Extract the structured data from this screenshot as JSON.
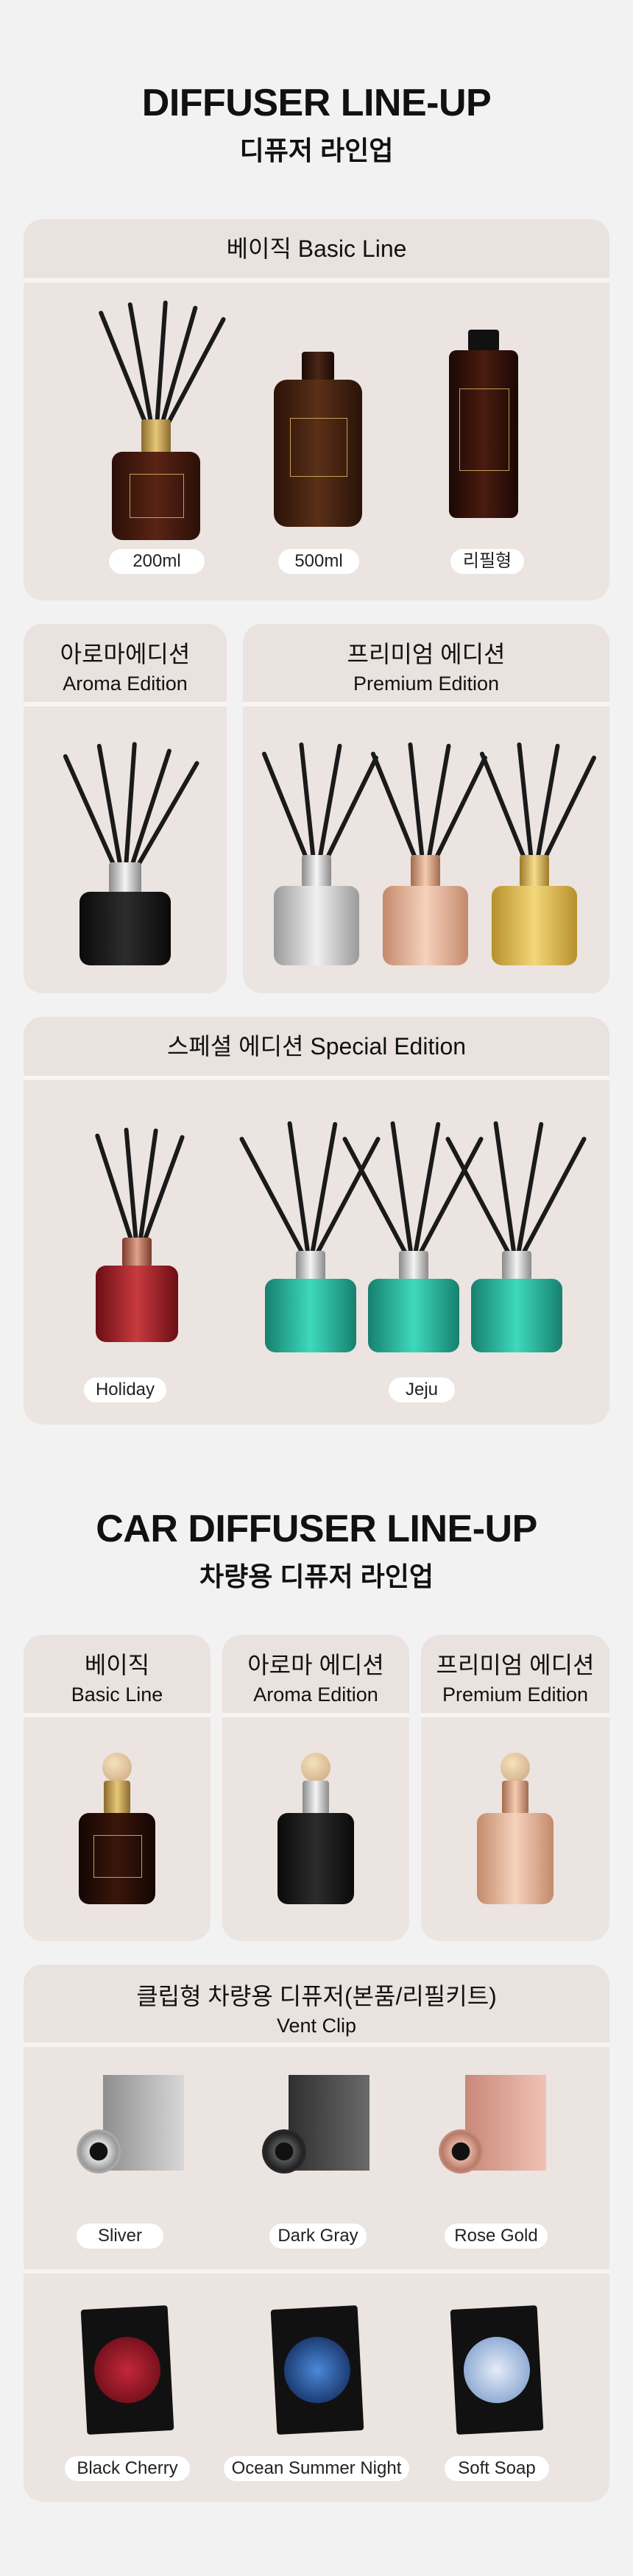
{
  "section1": {
    "title_en": "DIFFUSER LINE-UP",
    "title_ko": "디퓨저 라인업",
    "basic": {
      "header": "베이직 Basic Line",
      "labels": [
        "200ml",
        "500ml",
        "리필형"
      ]
    },
    "aroma": {
      "header_ko": "아로마에디션",
      "header_en": "Aroma Edition"
    },
    "premium": {
      "header_ko": "프리미엄 에디션",
      "header_en": "Premium Edition"
    },
    "special": {
      "header": "스페셜 에디션 Special Edition",
      "labels": [
        "Holiday",
        "Jeju"
      ]
    }
  },
  "section2": {
    "title_en": "CAR DIFFUSER LINE-UP",
    "title_ko": "차량용 디퓨저 라인업",
    "basic": {
      "header_ko": "베이직",
      "header_en": "Basic Line"
    },
    "aroma": {
      "header_ko": "아로마 에디션",
      "header_en": "Aroma Edition"
    },
    "premium": {
      "header_ko": "프리미엄 에디션",
      "header_en": "Premium Edition"
    },
    "vent": {
      "header_ko": "클립형 차량용 디퓨저(본품/리필키트)",
      "header_en": "Vent Clip",
      "colors": [
        "Sliver",
        "Dark Gray",
        "Rose Gold"
      ],
      "refills": [
        "Black Cherry",
        "Ocean Summer Night",
        "Soft Soap"
      ]
    }
  },
  "colors": {
    "page_bg": "#f2f2f2",
    "card_bg": "#ebe4e1",
    "amber": "#4a1e14",
    "black": "#1a1a1a",
    "silver": "#c9c9c9",
    "rose_gold": "#e0a98c",
    "gold": "#d8b25a",
    "red": "#a8242a",
    "teal": "#2fbfa5"
  }
}
